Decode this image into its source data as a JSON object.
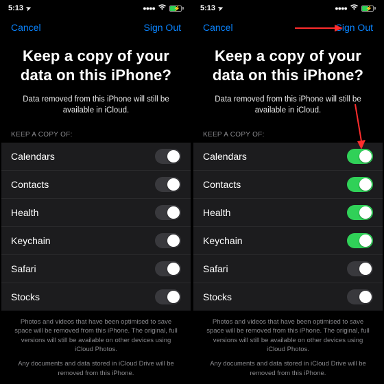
{
  "status": {
    "time": "5:13",
    "loc_glyph": "➤"
  },
  "nav": {
    "cancel": "Cancel",
    "signout": "Sign Out"
  },
  "title": "Keep a copy of your data on this iPhone?",
  "subtitle": "Data removed from this iPhone will still be available in iCloud.",
  "section_label": "KEEP A COPY OF:",
  "items": [
    {
      "label": "Calendars"
    },
    {
      "label": "Contacts"
    },
    {
      "label": "Health"
    },
    {
      "label": "Keychain"
    },
    {
      "label": "Safari"
    },
    {
      "label": "Stocks"
    }
  ],
  "left_states": [
    false,
    false,
    false,
    false,
    false,
    false
  ],
  "right_states": [
    true,
    true,
    true,
    true,
    false,
    false
  ],
  "footnote1": "Photos and videos that have been optimised to save space will be removed from this iPhone. The original, full versions will still be available on other devices using iCloud Photos.",
  "footnote2": "Any documents and data stored in iCloud Drive will be removed from this iPhone.",
  "colors": {
    "link": "#0a84ff",
    "toggle_on": "#30d158"
  }
}
